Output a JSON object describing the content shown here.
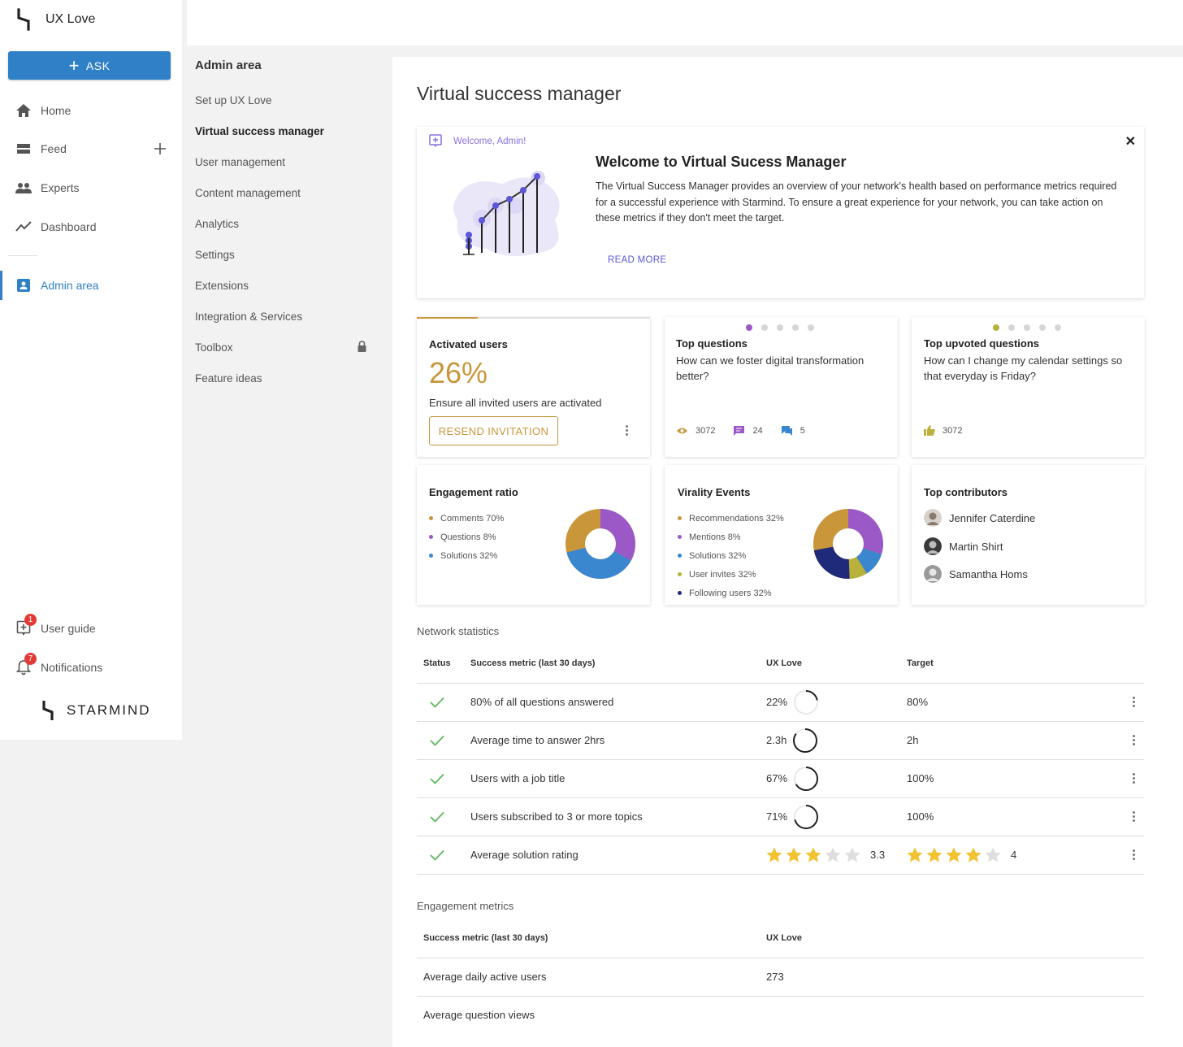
{
  "app": {
    "name": "UX Love",
    "brand": "STARMIND"
  },
  "sidebar": {
    "ask_label": "ASK",
    "items": [
      {
        "label": "Home",
        "icon": "home-icon"
      },
      {
        "label": "Feed",
        "icon": "feed-icon"
      },
      {
        "label": "Experts",
        "icon": "experts-icon"
      },
      {
        "label": "Dashboard",
        "icon": "dashboard-icon"
      },
      {
        "label": "Admin area",
        "icon": "admin-icon"
      }
    ],
    "user_guide": {
      "label": "User guide",
      "badge": "1"
    },
    "notifications": {
      "label": "Notifications",
      "badge": "7"
    }
  },
  "subnav": {
    "title": "Admin area",
    "items": [
      "Set up UX Love",
      "Virtual success manager",
      "User management",
      "Content management",
      "Analytics",
      "Settings",
      "Extensions",
      "Integration & Services",
      "Toolbox",
      "Feature ideas"
    ]
  },
  "page": {
    "title": "Virtual success manager"
  },
  "welcome": {
    "tag": "Welcome, Admin!",
    "title": "Welcome to Virtual Sucess Manager",
    "body": "The Virtual Success Manager provides an overview of your network's health based on performance metrics required for a successful experience with Starmind. To ensure a great experience for your network, you can take action on these metrics if they don't meet the target.",
    "read_more": "READ MORE"
  },
  "activated": {
    "title": "Activated users",
    "value": "26%",
    "progress": 0.26,
    "desc": "Ensure all invited users are activated",
    "button": "RESEND INVITATION"
  },
  "top_questions": {
    "title": "Top questions",
    "text": "How can we foster digital transformation better?",
    "views": "3072",
    "comments": "24",
    "answers": "5"
  },
  "top_upvoted": {
    "title": "Top upvoted questions",
    "text": "How can I change my calendar settings so that everyday is Friday?",
    "upvotes": "3072"
  },
  "engagement": {
    "title": "Engagement ratio",
    "legend": [
      {
        "label": "Comments 70%",
        "color": "#c9963a"
      },
      {
        "label": "Questions 8%",
        "color": "#9b59c7"
      },
      {
        "label": "Solutions 32%",
        "color": "#3a87cf"
      }
    ]
  },
  "virality": {
    "title": "Virality Events",
    "legend": [
      {
        "label": "Recommendations 32%",
        "color": "#c9963a"
      },
      {
        "label": "Mentions 8%",
        "color": "#9b59c7"
      },
      {
        "label": "Solutions 32%",
        "color": "#3a87cf"
      },
      {
        "label": "User invites 32%",
        "color": "#b8b13c"
      },
      {
        "label": "Following users 32%",
        "color": "#1f2a7a"
      }
    ]
  },
  "contributors": {
    "title": "Top contributors",
    "names": [
      "Jennifer Caterdine",
      "Martin Shirt",
      "Samantha Homs"
    ]
  },
  "network": {
    "title": "Network statistics",
    "headers": [
      "Status",
      "Success metric (last 30 days)",
      "UX Love",
      "Target"
    ],
    "rows": [
      {
        "metric": "80% of all questions answered",
        "value": "22%",
        "progress": 0.22,
        "target": "80%"
      },
      {
        "metric": "Average time to answer 2hrs",
        "value": "2.3h",
        "progress": 0.85,
        "target": "2h"
      },
      {
        "metric": "Users with a job title",
        "value": "67%",
        "progress": 0.67,
        "target": "100%"
      },
      {
        "metric": "Users subscribed to 3 or more topics",
        "value": "71%",
        "progress": 0.71,
        "target": "100%"
      }
    ],
    "rating": {
      "metric": "Average solution rating",
      "value": "3.3",
      "value_stars": 3,
      "target": "4",
      "target_stars": 4
    }
  },
  "engagement_metrics": {
    "title": "Engagement metrics",
    "headers": [
      "Success metric (last 30 days)",
      "UX Love"
    ],
    "rows": [
      {
        "metric": "Average daily active users",
        "value": "273"
      },
      {
        "metric": "Average question views",
        "value": ""
      }
    ]
  }
}
